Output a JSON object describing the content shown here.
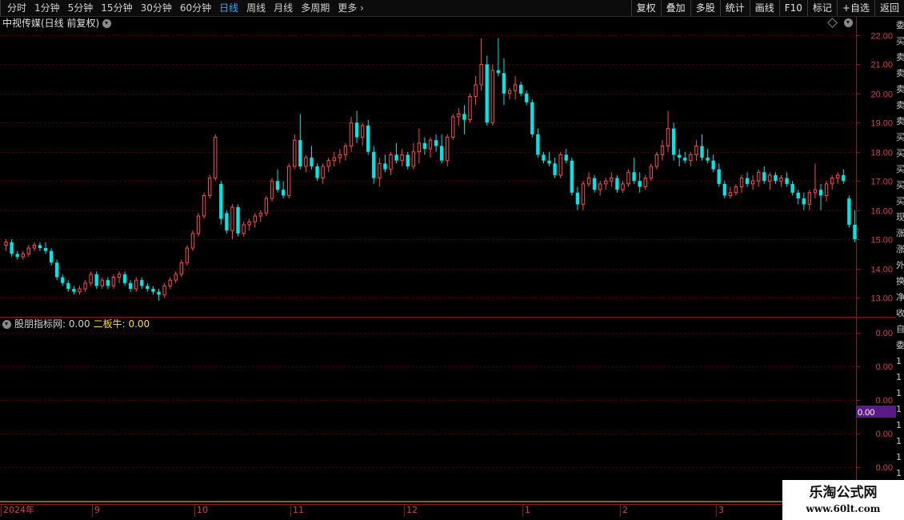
{
  "toolbar": {
    "periods": [
      {
        "label": "分时",
        "active": false
      },
      {
        "label": "1分钟",
        "active": false
      },
      {
        "label": "5分钟",
        "active": false
      },
      {
        "label": "15分钟",
        "active": false
      },
      {
        "label": "30分钟",
        "active": false
      },
      {
        "label": "60分钟",
        "active": false
      },
      {
        "label": "日线",
        "active": true
      },
      {
        "label": "周线",
        "active": false
      },
      {
        "label": "月线",
        "active": false
      },
      {
        "label": "多周期",
        "active": false
      },
      {
        "label": "更多",
        "active": false
      }
    ],
    "buttons": [
      "复权",
      "叠加",
      "多股",
      "统计",
      "画线",
      "F10",
      "标记",
      "+自选",
      "返回"
    ]
  },
  "chart": {
    "title": "中视传媒(日线 前复权)",
    "price_axis": [
      "22.00",
      "21.00",
      "20.00",
      "19.00",
      "18.00",
      "17.00",
      "16.00",
      "15.00",
      "14.00",
      "13.00"
    ]
  },
  "indicator": {
    "name": "股朋指标网",
    "name_value": ": 0.00",
    "series_label": "二板牛: 0.00",
    "axis": [
      "0.00",
      "0.00",
      "0.00",
      "0.00",
      "0.00"
    ],
    "current_value": "0.00"
  },
  "dates": [
    "2024年",
    "9",
    "10",
    "11",
    "12",
    "1",
    "2",
    "3"
  ],
  "watermark": {
    "title": "乐淘公式网",
    "url": "www.60lt.com"
  },
  "right_strip": [
    "委",
    "买",
    "卖",
    "卖",
    "卖",
    "卖",
    "卖",
    "买",
    "买",
    "买",
    "买",
    "买",
    "现",
    "涨",
    "涨",
    "外",
    "换",
    "净",
    "收",
    "自",
    "委",
    "1",
    "1",
    "1",
    "1",
    "1",
    "1",
    "1",
    "1",
    "1"
  ],
  "colors": {
    "up": "#ff4a4a",
    "down": "#00e6e6",
    "grid": "#5a0000",
    "axis_text": "#d04848",
    "indicator_value": "#ffd84a",
    "current_value_bg": "#5a1a8a"
  },
  "chart_data": {
    "type": "candlestick",
    "title": "中视传媒(日线 前复权)",
    "ylim": [
      12.5,
      22.3
    ],
    "y_ticks": [
      22,
      21,
      20,
      19,
      18,
      17,
      16,
      15,
      14,
      13
    ],
    "x_labels": [
      "2024年",
      "9",
      "10",
      "11",
      "12",
      "1",
      "2",
      "3"
    ],
    "ohlc": [
      [
        14.8,
        15.0,
        14.6,
        14.9
      ],
      [
        14.9,
        15.0,
        14.4,
        14.5
      ],
      [
        14.5,
        14.6,
        14.3,
        14.4
      ],
      [
        14.4,
        14.6,
        14.3,
        14.5
      ],
      [
        14.5,
        14.8,
        14.4,
        14.7
      ],
      [
        14.7,
        14.9,
        14.6,
        14.8
      ],
      [
        14.8,
        14.9,
        14.6,
        14.7
      ],
      [
        14.7,
        14.9,
        14.5,
        14.6
      ],
      [
        14.6,
        14.7,
        14.1,
        14.2
      ],
      [
        14.2,
        14.3,
        13.6,
        13.7
      ],
      [
        13.7,
        13.8,
        13.4,
        13.5
      ],
      [
        13.5,
        13.6,
        13.2,
        13.3
      ],
      [
        13.3,
        13.4,
        13.1,
        13.2
      ],
      [
        13.2,
        13.4,
        13.1,
        13.3
      ],
      [
        13.3,
        13.6,
        13.2,
        13.5
      ],
      [
        13.5,
        13.9,
        13.4,
        13.8
      ],
      [
        13.8,
        13.9,
        13.3,
        13.4
      ],
      [
        13.4,
        13.7,
        13.3,
        13.6
      ],
      [
        13.6,
        13.7,
        13.3,
        13.4
      ],
      [
        13.4,
        13.8,
        13.3,
        13.7
      ],
      [
        13.7,
        13.9,
        13.5,
        13.8
      ],
      [
        13.8,
        13.9,
        13.4,
        13.5
      ],
      [
        13.5,
        13.6,
        13.2,
        13.3
      ],
      [
        13.3,
        13.7,
        13.2,
        13.6
      ],
      [
        13.6,
        13.7,
        13.3,
        13.4
      ],
      [
        13.4,
        13.5,
        13.2,
        13.3
      ],
      [
        13.3,
        13.4,
        13.1,
        13.2
      ],
      [
        13.2,
        13.3,
        12.9,
        13.1
      ],
      [
        13.1,
        13.5,
        13.0,
        13.4
      ],
      [
        13.4,
        13.7,
        13.3,
        13.6
      ],
      [
        13.6,
        13.9,
        13.5,
        13.8
      ],
      [
        13.8,
        14.3,
        13.7,
        14.2
      ],
      [
        14.2,
        14.8,
        14.1,
        14.7
      ],
      [
        14.7,
        15.3,
        14.6,
        15.2
      ],
      [
        15.2,
        15.9,
        15.1,
        15.8
      ],
      [
        15.8,
        16.6,
        15.7,
        16.5
      ],
      [
        16.5,
        17.2,
        16.4,
        17.1
      ],
      [
        17.1,
        18.6,
        17.0,
        18.5
      ],
      [
        16.9,
        17.0,
        15.5,
        15.7
      ],
      [
        15.9,
        16.0,
        15.2,
        15.3
      ],
      [
        15.3,
        16.2,
        15.0,
        16.1
      ],
      [
        16.1,
        16.2,
        15.1,
        15.2
      ],
      [
        15.2,
        15.6,
        15.1,
        15.5
      ],
      [
        15.5,
        15.7,
        15.3,
        15.6
      ],
      [
        15.6,
        15.9,
        15.4,
        15.8
      ],
      [
        15.8,
        16.0,
        15.6,
        15.9
      ],
      [
        15.9,
        16.5,
        15.8,
        16.4
      ],
      [
        16.4,
        17.1,
        16.3,
        17.0
      ],
      [
        17.0,
        17.4,
        16.6,
        16.7
      ],
      [
        16.7,
        17.0,
        16.4,
        16.5
      ],
      [
        16.5,
        17.6,
        16.4,
        17.5
      ],
      [
        17.5,
        18.6,
        17.4,
        18.4
      ],
      [
        18.4,
        19.3,
        17.4,
        17.5
      ],
      [
        17.5,
        17.9,
        17.3,
        17.8
      ],
      [
        17.8,
        18.2,
        17.4,
        17.5
      ],
      [
        17.5,
        17.6,
        17.0,
        17.1
      ],
      [
        17.1,
        17.6,
        16.9,
        17.5
      ],
      [
        17.5,
        17.8,
        17.3,
        17.7
      ],
      [
        17.7,
        18.0,
        17.5,
        17.8
      ],
      [
        17.8,
        18.1,
        17.6,
        17.9
      ],
      [
        17.9,
        18.3,
        17.7,
        18.2
      ],
      [
        18.2,
        19.2,
        18.0,
        19.0
      ],
      [
        19.0,
        19.4,
        18.3,
        18.5
      ],
      [
        18.5,
        19.0,
        18.2,
        18.9
      ],
      [
        18.9,
        19.1,
        17.9,
        18.0
      ],
      [
        18.0,
        18.2,
        16.9,
        17.1
      ],
      [
        17.1,
        17.8,
        16.8,
        17.6
      ],
      [
        17.6,
        17.9,
        17.3,
        17.4
      ],
      [
        17.4,
        18.0,
        17.2,
        17.9
      ],
      [
        17.9,
        18.3,
        17.6,
        17.7
      ],
      [
        17.7,
        18.1,
        17.5,
        17.9
      ],
      [
        17.9,
        18.0,
        17.4,
        17.5
      ],
      [
        17.5,
        18.3,
        17.4,
        18.0
      ],
      [
        18.0,
        18.8,
        17.6,
        18.3
      ],
      [
        18.3,
        18.5,
        17.9,
        18.1
      ],
      [
        18.1,
        18.5,
        17.8,
        18.4
      ],
      [
        18.4,
        18.6,
        18.0,
        18.2
      ],
      [
        18.2,
        18.6,
        17.6,
        17.7
      ],
      [
        17.7,
        18.6,
        17.5,
        18.5
      ],
      [
        18.5,
        19.3,
        18.4,
        19.2
      ],
      [
        19.2,
        19.5,
        18.9,
        19.3
      ],
      [
        19.3,
        19.6,
        18.6,
        19.1
      ],
      [
        19.1,
        20.0,
        19.0,
        19.9
      ],
      [
        19.9,
        20.6,
        19.6,
        20.3
      ],
      [
        20.3,
        21.9,
        20.1,
        21.0
      ],
      [
        21.0,
        21.3,
        18.9,
        19.0
      ],
      [
        19.0,
        21.0,
        18.9,
        20.8
      ],
      [
        20.8,
        21.9,
        20.6,
        20.7
      ],
      [
        20.7,
        21.2,
        19.6,
        20.0
      ],
      [
        20.0,
        20.2,
        19.8,
        20.1
      ],
      [
        20.1,
        20.6,
        19.8,
        20.3
      ],
      [
        20.3,
        20.4,
        19.9,
        20.0
      ],
      [
        20.0,
        20.1,
        19.6,
        19.7
      ],
      [
        19.7,
        19.8,
        18.5,
        18.6
      ],
      [
        18.6,
        18.8,
        17.8,
        17.9
      ],
      [
        17.9,
        18.0,
        17.6,
        17.7
      ],
      [
        17.7,
        18.0,
        17.5,
        17.6
      ],
      [
        17.6,
        17.8,
        17.1,
        17.2
      ],
      [
        17.2,
        18.0,
        17.1,
        17.9
      ],
      [
        17.9,
        18.1,
        17.6,
        17.7
      ],
      [
        17.7,
        17.8,
        16.5,
        16.6
      ],
      [
        16.6,
        16.8,
        16.0,
        16.2
      ],
      [
        16.2,
        17.0,
        16.0,
        16.9
      ],
      [
        16.9,
        17.3,
        16.8,
        17.1
      ],
      [
        17.1,
        17.2,
        16.6,
        16.7
      ],
      [
        16.7,
        17.0,
        16.5,
        16.9
      ],
      [
        16.9,
        17.1,
        16.7,
        17.0
      ],
      [
        17.0,
        17.3,
        16.8,
        17.1
      ],
      [
        17.1,
        17.2,
        16.6,
        16.7
      ],
      [
        16.7,
        17.0,
        16.6,
        16.9
      ],
      [
        16.9,
        17.4,
        16.8,
        17.3
      ],
      [
        17.3,
        17.8,
        16.9,
        17.0
      ],
      [
        17.0,
        17.3,
        16.6,
        16.8
      ],
      [
        16.8,
        17.2,
        16.7,
        17.1
      ],
      [
        17.1,
        17.6,
        17.0,
        17.5
      ],
      [
        17.5,
        18.0,
        17.4,
        17.9
      ],
      [
        17.9,
        18.4,
        17.7,
        18.2
      ],
      [
        18.2,
        19.4,
        18.0,
        18.8
      ],
      [
        18.8,
        19.0,
        17.7,
        17.9
      ],
      [
        17.9,
        18.1,
        17.5,
        17.8
      ],
      [
        17.8,
        18.0,
        17.6,
        17.7
      ],
      [
        17.7,
        18.0,
        17.5,
        17.9
      ],
      [
        17.9,
        18.4,
        17.7,
        18.2
      ],
      [
        18.2,
        18.6,
        17.7,
        17.8
      ],
      [
        17.8,
        18.1,
        17.6,
        17.7
      ],
      [
        17.7,
        17.9,
        17.3,
        17.4
      ],
      [
        17.4,
        17.6,
        16.8,
        16.9
      ],
      [
        16.9,
        17.0,
        16.4,
        16.5
      ],
      [
        16.5,
        16.8,
        16.4,
        16.6
      ],
      [
        16.6,
        16.9,
        16.5,
        16.8
      ],
      [
        16.8,
        17.2,
        16.6,
        17.1
      ],
      [
        17.1,
        17.3,
        16.8,
        16.9
      ],
      [
        16.9,
        17.2,
        16.7,
        17.0
      ],
      [
        17.0,
        17.4,
        16.8,
        17.3
      ],
      [
        17.3,
        17.5,
        16.9,
        17.0
      ],
      [
        17.0,
        17.3,
        16.7,
        17.2
      ],
      [
        17.2,
        17.3,
        16.9,
        17.0
      ],
      [
        17.0,
        17.2,
        16.8,
        17.1
      ],
      [
        17.1,
        17.3,
        16.8,
        16.9
      ],
      [
        16.9,
        17.0,
        16.5,
        16.6
      ],
      [
        16.6,
        16.7,
        16.2,
        16.4
      ],
      [
        16.4,
        16.6,
        16.0,
        16.2
      ],
      [
        16.2,
        16.7,
        16.0,
        16.6
      ],
      [
        16.6,
        17.6,
        16.4,
        16.7
      ],
      [
        16.7,
        16.9,
        16.0,
        16.5
      ],
      [
        16.5,
        17.0,
        16.3,
        16.9
      ],
      [
        16.9,
        17.2,
        16.7,
        17.1
      ],
      [
        17.1,
        17.3,
        16.9,
        17.2
      ],
      [
        17.2,
        17.4,
        16.9,
        17.0
      ],
      [
        16.4,
        16.5,
        15.4,
        15.5
      ],
      [
        15.5,
        16.0,
        14.9,
        15.0
      ]
    ]
  }
}
